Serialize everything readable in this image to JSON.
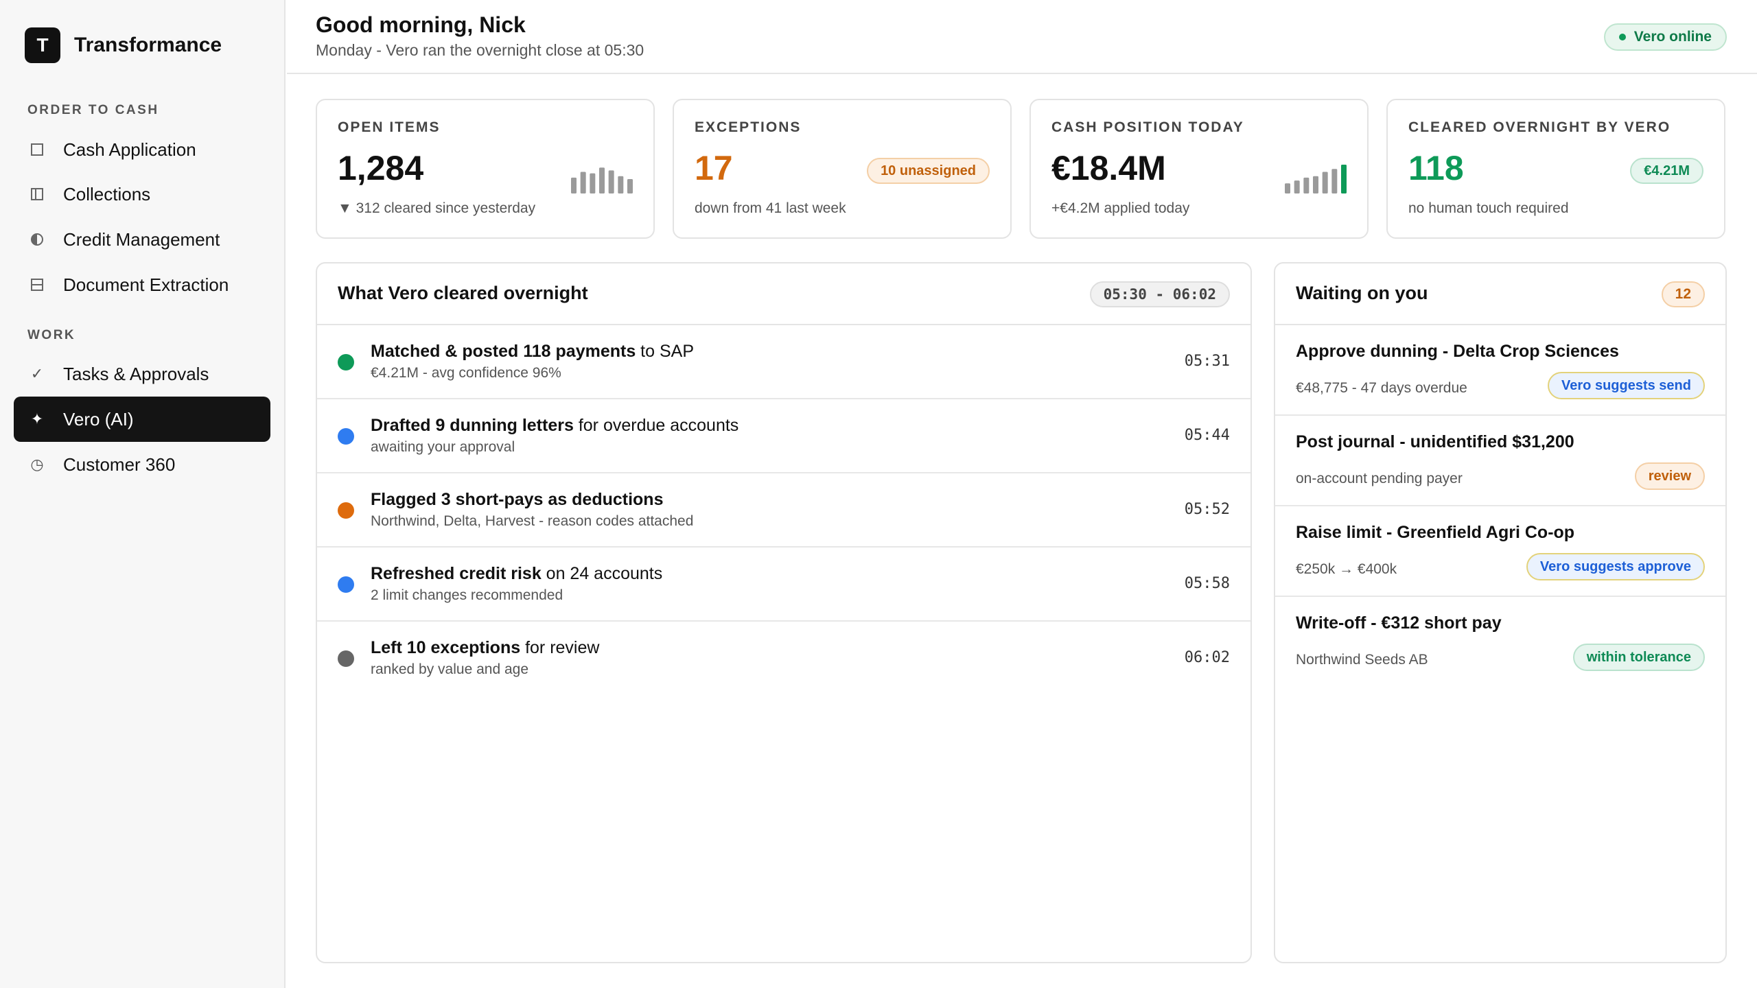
{
  "brand": {
    "logo_letter": "T",
    "name": "Transformance"
  },
  "sidebar": {
    "sections": [
      {
        "label": "ORDER TO CASH"
      },
      {
        "label": "WORK"
      }
    ],
    "items": [
      {
        "label": "Cash Application",
        "icon": "square-icon"
      },
      {
        "label": "Collections",
        "icon": "columns-icon"
      },
      {
        "label": "Credit Management",
        "icon": "half-circle-icon"
      },
      {
        "label": "Document Extraction",
        "icon": "document-icon"
      },
      {
        "label": "Tasks & Approvals",
        "icon": "check-icon"
      },
      {
        "label": "Vero (AI)",
        "icon": "sparkle-icon",
        "active": true
      },
      {
        "label": "Customer 360",
        "icon": "clock-icon"
      }
    ]
  },
  "header": {
    "greeting": "Good morning, Nick",
    "subtitle": "Monday - Vero ran the overnight close at 05:30",
    "status": "Vero online"
  },
  "kpis": [
    {
      "title": "OPEN ITEMS",
      "value": "1,284",
      "sub": "▼ 312 cleared since yesterday",
      "spark": [
        0.55,
        0.75,
        0.7,
        0.9,
        0.8,
        0.6,
        0.5
      ],
      "spark_color": "#9a9a9a"
    },
    {
      "title": "EXCEPTIONS",
      "value": "17",
      "sub": "down from 41 last week",
      "badge": "10 unassigned",
      "value_color": "#d2690e"
    },
    {
      "title": "CASH POSITION TODAY",
      "value": "€18.4M",
      "sub": "+€4.2M applied today",
      "spark": [
        0.35,
        0.45,
        0.55,
        0.6,
        0.75,
        0.85,
        1.0
      ],
      "spark_color": "#9a9a9a",
      "spark_last_color": "#0e9a58"
    },
    {
      "title": "CLEARED OVERNIGHT BY VERO",
      "value": "118",
      "sub": "no human touch required",
      "badge": "€4.21M",
      "value_color": "#0e9a58"
    }
  ],
  "activity": {
    "title": "What Vero cleared overnight",
    "range": "05:30 - 06:02",
    "rows": [
      {
        "bold": "Matched & posted 118 payments",
        "rest": " to SAP",
        "sub": "€4.21M - avg confidence 96%",
        "time": "05:31",
        "color": "#0e9a58"
      },
      {
        "bold": "Drafted 9 dunning letters",
        "rest": " for overdue accounts",
        "sub": "awaiting your approval",
        "time": "05:44",
        "color": "#2f7cf0"
      },
      {
        "bold": "Flagged 3 short-pays as deductions",
        "rest": "",
        "sub": "Northwind, Delta, Harvest - reason codes attached",
        "time": "05:52",
        "color": "#de6b0d"
      },
      {
        "bold": "Refreshed credit risk",
        "rest": " on 24 accounts",
        "sub": "2 limit changes recommended",
        "time": "05:58",
        "color": "#2f7cf0"
      },
      {
        "bold": "Left 10 exceptions",
        "rest": " for review",
        "sub": "ranked by value and age",
        "time": "06:02",
        "color": "#666666"
      }
    ]
  },
  "waiting": {
    "title": "Waiting on you",
    "count": "12",
    "rows": [
      {
        "title": "Approve dunning - Delta Crop Sciences",
        "sub": "€48,775 - 47 days overdue",
        "tag": "Vero suggests send",
        "tag_style": "blue"
      },
      {
        "title": "Post journal - unidentified $31,200",
        "sub": "on-account pending payer",
        "tag": "review",
        "tag_style": "orange"
      },
      {
        "title": "Raise limit - Greenfield Agri Co-op",
        "sub": "€250k → €400k",
        "tag": "Vero suggests approve",
        "tag_style": "blue"
      },
      {
        "title": "Write-off - €312 short pay",
        "sub": "Northwind Seeds AB",
        "tag": "within tolerance",
        "tag_style": "green"
      }
    ]
  }
}
